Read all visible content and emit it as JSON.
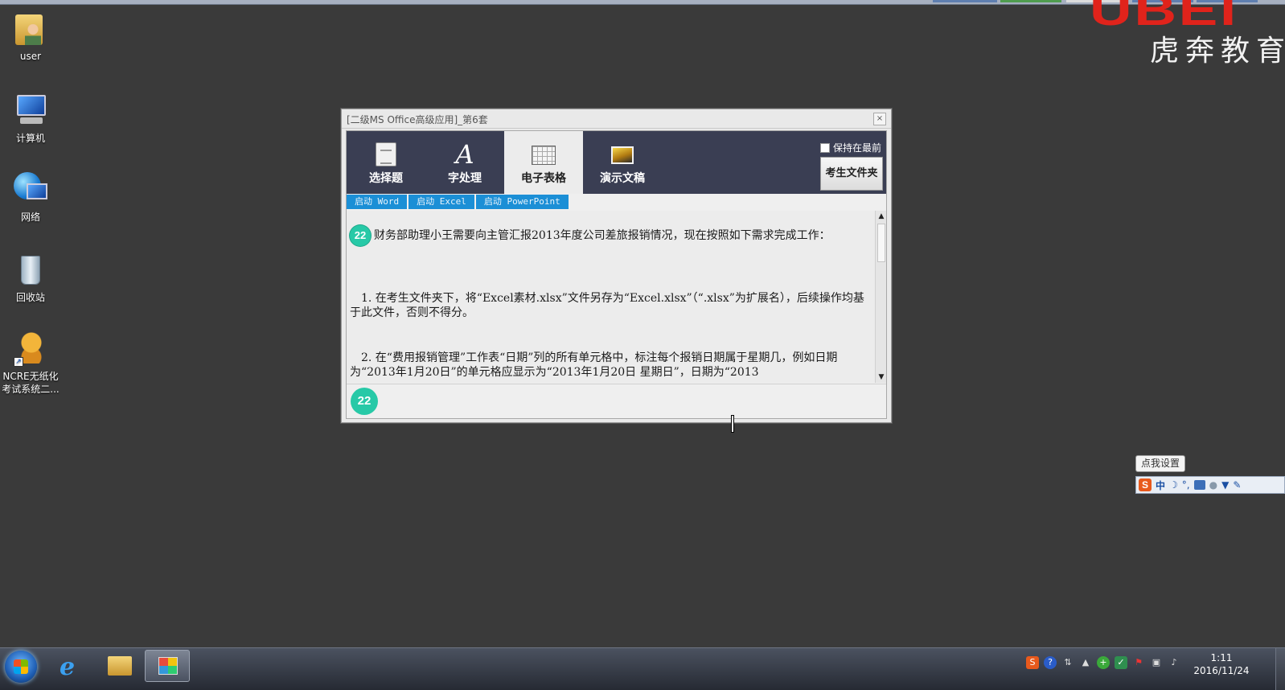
{
  "brand": {
    "name": "虎奔教育"
  },
  "desktop": {
    "icons": [
      {
        "label": "user"
      },
      {
        "label": "计算机"
      },
      {
        "label": "网络"
      },
      {
        "label": "回收站"
      },
      {
        "label_line1": "NCRE无纸化",
        "label_line2": "考试系统二..."
      }
    ]
  },
  "dialog": {
    "title": "[二级MS Office高级应用]_第6套",
    "close_label": "×",
    "tabs": [
      {
        "label": "选择题"
      },
      {
        "label": "字处理"
      },
      {
        "label": "电子表格"
      },
      {
        "label": "演示文稿"
      }
    ],
    "active_tab": "电子表格",
    "keep_on_top_label": "保持在最前",
    "keep_on_top_checked": false,
    "exam_folder_label": "考生文件夹",
    "launchers": [
      {
        "label": "启动 Word"
      },
      {
        "label": "启动 Excel"
      },
      {
        "label": "启动 PowerPoint"
      }
    ],
    "question_number": "22",
    "paragraphs": [
      "财务部助理小王需要向主管汇报2013年度公司差旅报销情况，现在按照如下需求完成工作：",
      "1. 在考生文件夹下，将“Excel素材.xlsx”文件另存为“Excel.xlsx”（“.xlsx”为扩展名），后续操作均基于此文件，否则不得分。",
      "2. 在“费用报销管理”工作表“日期”列的所有单元格中，标注每个报销日期属于星期几，例如日期为“2013年1月20日”的单元格应显示为“2013年1月20日 星期日”，日期为“2013"
    ],
    "nav_number": "22"
  },
  "ime": {
    "tip": "点我设置",
    "mode": "中"
  },
  "taskbar": {
    "clock_time": "1:11",
    "clock_date": "2016/11/24"
  }
}
